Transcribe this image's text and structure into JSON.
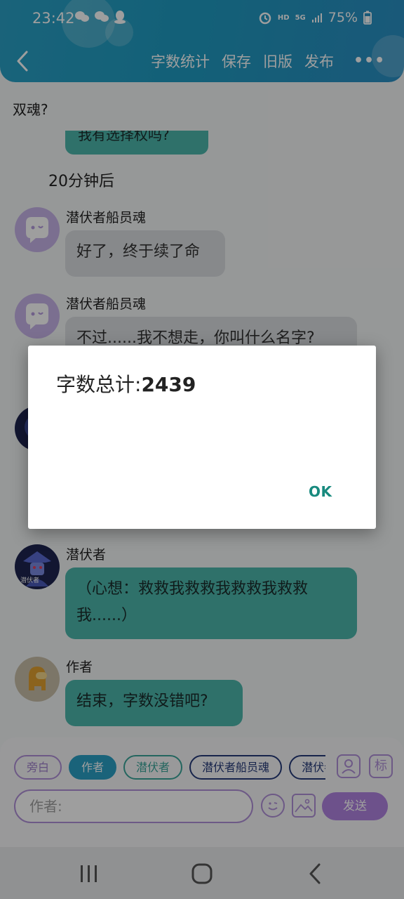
{
  "status_bar": {
    "time": "23:42",
    "battery": "75%",
    "hd_label": "HD",
    "network_label": "5G"
  },
  "toolbar": {
    "items": [
      "字数统计",
      "保存",
      "旧版",
      "发布"
    ],
    "more": "•••"
  },
  "story_title": "双魂?",
  "clipped_message": "我有选择权吗?",
  "narration": "20分钟后",
  "messages": [
    {
      "sender": "潜伏者船员魂",
      "text": "好了，终于续了命"
    },
    {
      "sender": "潜伏者船员魂",
      "text": "不过......我不想走，你叫什么名字?"
    },
    {
      "sender": "潜伏者",
      "text_line1": "（心想：救救我救救我救救我救救",
      "text_line2": "我......）"
    },
    {
      "sender": "作者",
      "text": "结束，字数没错吧?"
    }
  ],
  "bottom": {
    "roles": [
      "旁白",
      "作者",
      "潜伏者",
      "潜伏者船员魂",
      "潜伏者"
    ],
    "badge_label": "标",
    "input_placeholder": "作者:",
    "send_label": "发送"
  },
  "dialog": {
    "message_label": "字数总计:",
    "message_value": "2439",
    "ok_label": "OK"
  },
  "avatar_label": "潜伏者",
  "colors": {
    "header": "#2aa1c6",
    "teal_bubble": "#4cb7ab",
    "purple_accent": "#b090d8",
    "dialog_button": "#188a7e"
  }
}
